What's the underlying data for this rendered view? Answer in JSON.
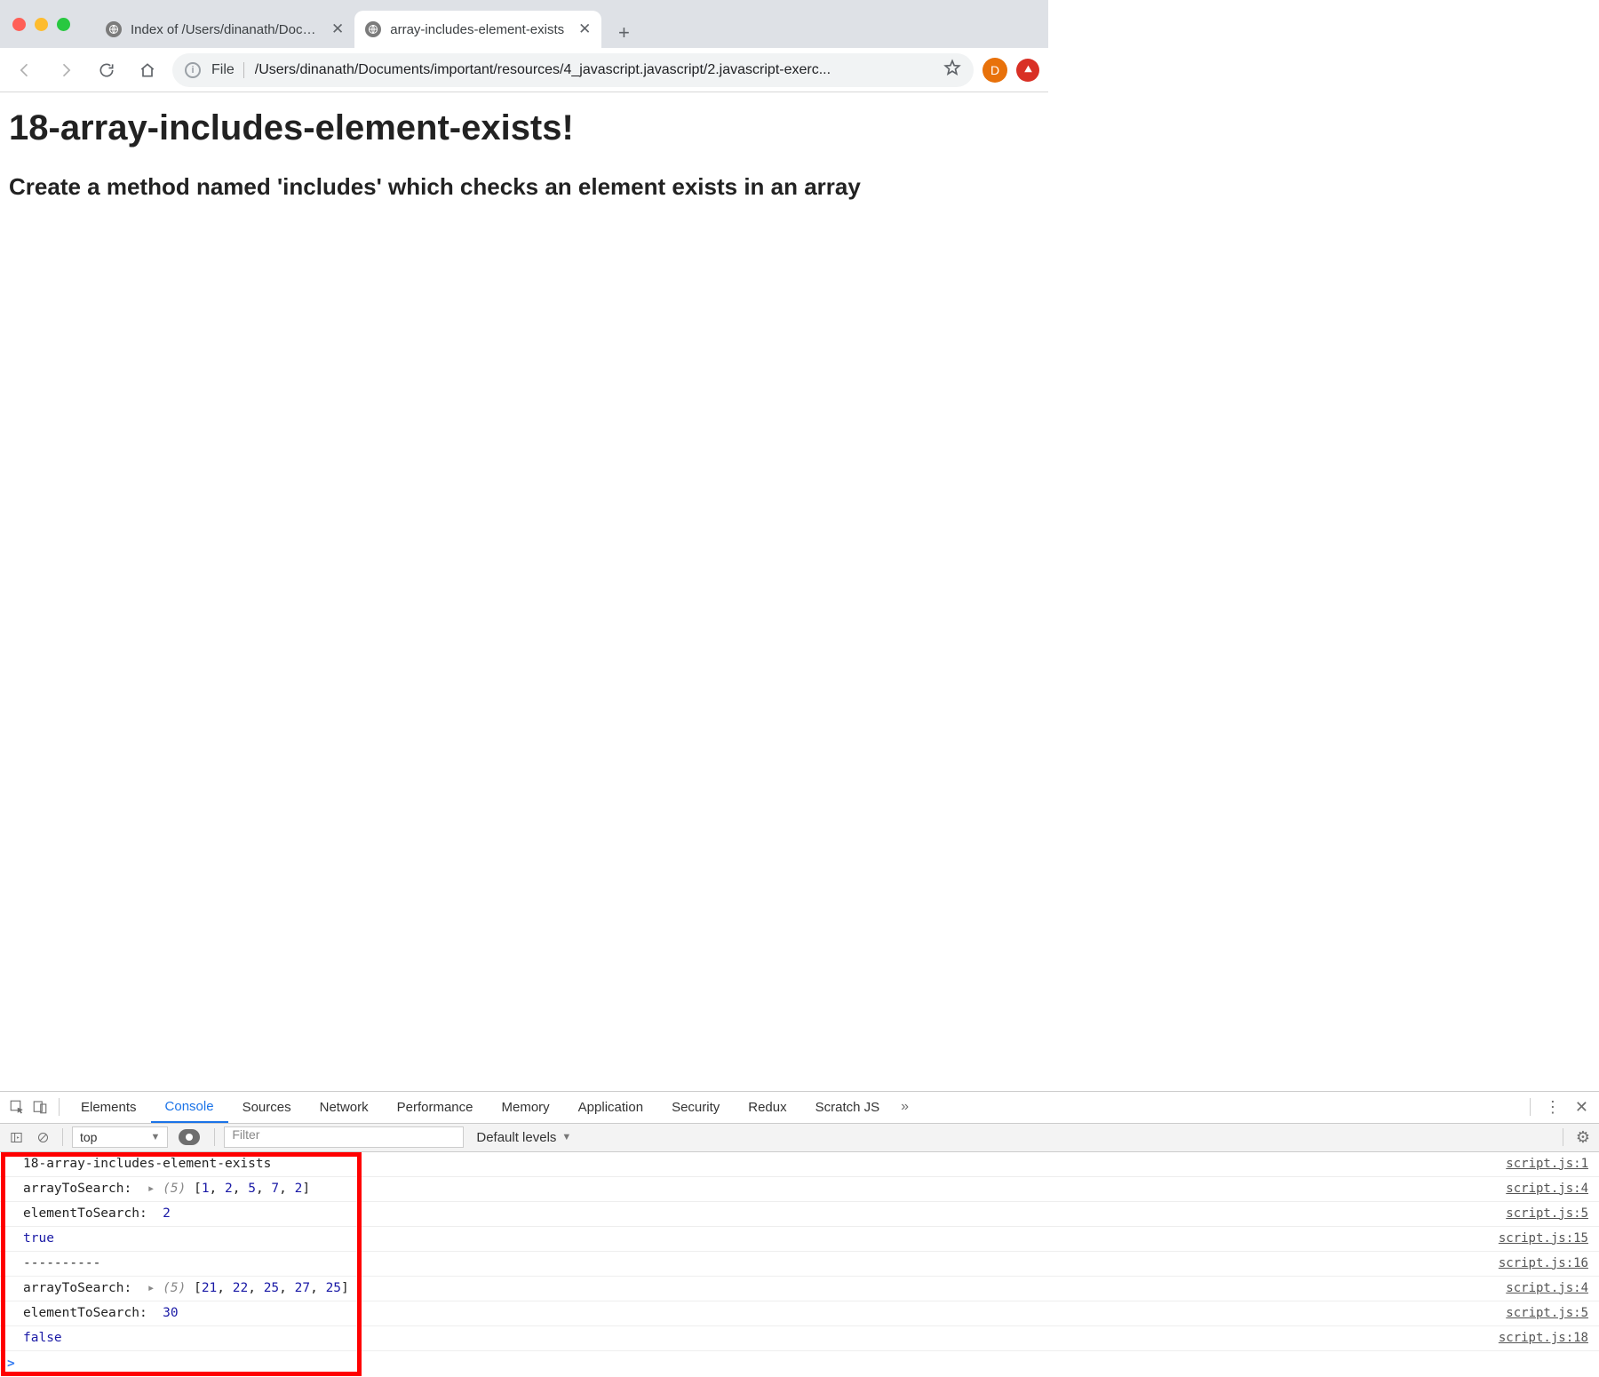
{
  "browser": {
    "tabs": [
      {
        "title": "Index of /Users/dinanath/Docum",
        "active": false
      },
      {
        "title": "array-includes-element-exists",
        "active": true
      }
    ],
    "url_file_label": "File",
    "url": "/Users/dinanath/Documents/important/resources/4_javascript.javascript/2.javascript-exerc...",
    "profile_initial": "D"
  },
  "page": {
    "h1": "18-array-includes-element-exists!",
    "h2": "Create a method named 'includes' which checks an element exists in an array"
  },
  "devtools": {
    "tabs": [
      "Elements",
      "Console",
      "Sources",
      "Network",
      "Performance",
      "Memory",
      "Application",
      "Security",
      "Redux",
      "Scratch JS"
    ],
    "active_tab": "Console",
    "context": "top",
    "filter_placeholder": "Filter",
    "levels_label": "Default levels",
    "overflow": "»",
    "console": [
      {
        "text": "18-array-includes-element-exists",
        "src": "script.js:1"
      },
      {
        "label": "arrayToSearch:",
        "array_len": 5,
        "array": [
          1,
          2,
          5,
          7,
          2
        ],
        "src": "script.js:4"
      },
      {
        "label": "elementToSearch:",
        "value": 2,
        "src": "script.js:5"
      },
      {
        "bool": "true",
        "src": "script.js:15"
      },
      {
        "text": "----------",
        "src": "script.js:16"
      },
      {
        "label": "arrayToSearch:",
        "array_len": 5,
        "array": [
          21,
          22,
          25,
          27,
          25
        ],
        "src": "script.js:4"
      },
      {
        "label": "elementToSearch:",
        "value": 30,
        "src": "script.js:5"
      },
      {
        "bool": "false",
        "src": "script.js:18"
      }
    ],
    "prompt": ">"
  }
}
